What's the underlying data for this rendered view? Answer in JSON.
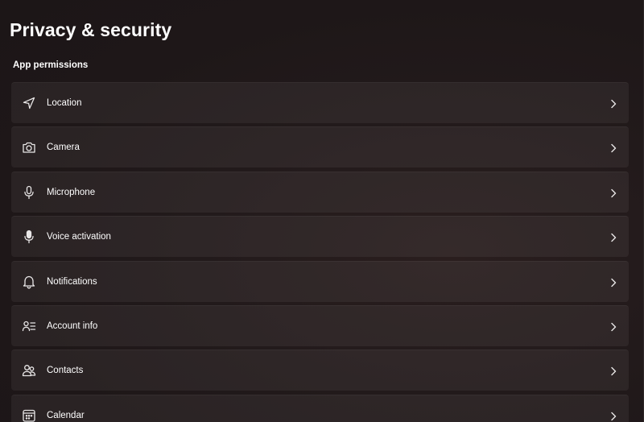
{
  "page": {
    "title": "Privacy & security",
    "section_title": "App permissions"
  },
  "items": [
    {
      "label": "Location",
      "icon": "location-icon"
    },
    {
      "label": "Camera",
      "icon": "camera-icon"
    },
    {
      "label": "Microphone",
      "icon": "microphone-icon"
    },
    {
      "label": "Voice activation",
      "icon": "voice-activation-icon"
    },
    {
      "label": "Notifications",
      "icon": "bell-icon"
    },
    {
      "label": "Account info",
      "icon": "account-info-icon"
    },
    {
      "label": "Contacts",
      "icon": "contacts-icon"
    },
    {
      "label": "Calendar",
      "icon": "calendar-icon"
    }
  ],
  "colors": {
    "background": "#201819",
    "row_background": "#2c2526",
    "text": "#ffffff"
  }
}
